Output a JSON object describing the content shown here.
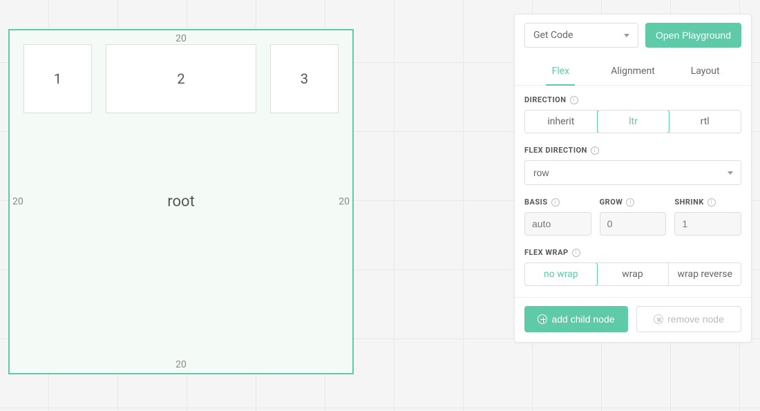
{
  "canvas": {
    "root_label": "root",
    "padding": {
      "top": "20",
      "right": "20",
      "bottom": "20",
      "left": "20"
    },
    "children": [
      {
        "label": "1"
      },
      {
        "label": "2"
      },
      {
        "label": "3"
      }
    ]
  },
  "toolbar": {
    "get_code_label": "Get Code",
    "open_playground_label": "Open Playground"
  },
  "tabs": {
    "flex": "Flex",
    "alignment": "Alignment",
    "layout": "Layout"
  },
  "sections": {
    "direction": {
      "label": "DIRECTION",
      "options": [
        "inherit",
        "ltr",
        "rtl"
      ],
      "selected": "ltr"
    },
    "flex_direction": {
      "label": "FLEX DIRECTION",
      "value": "row"
    },
    "basis": {
      "label": "BASIS",
      "placeholder": "auto"
    },
    "grow": {
      "label": "GROW",
      "placeholder": "0"
    },
    "shrink": {
      "label": "SHRINK",
      "placeholder": "1"
    },
    "flex_wrap": {
      "label": "FLEX WRAP",
      "options": [
        "no wrap",
        "wrap",
        "wrap reverse"
      ],
      "selected": "no wrap"
    }
  },
  "actions": {
    "add_child": "add child node",
    "remove_node": "remove node"
  }
}
